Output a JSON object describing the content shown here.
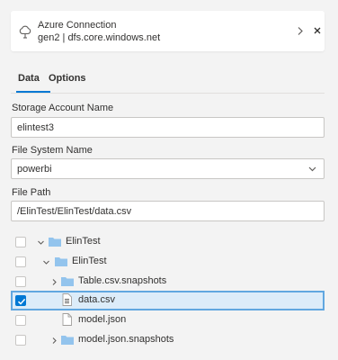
{
  "connection": {
    "title": "Azure Connection",
    "subtitle": "gen2 | dfs.core.windows.net",
    "icon": "cloud-icon"
  },
  "tabs": [
    {
      "label": "Data",
      "active": true
    },
    {
      "label": "Options",
      "active": false
    }
  ],
  "fields": {
    "storage_account": {
      "label": "Storage Account Name",
      "value": "elintest3"
    },
    "file_system": {
      "label": "File System Name",
      "value": "powerbi"
    },
    "file_path": {
      "label": "File Path",
      "value": "/ElinTest/ElinTest/data.csv"
    }
  },
  "tree": [
    {
      "label": "ElinTest",
      "type": "folder",
      "depth": 0,
      "expanded": true,
      "checked": false
    },
    {
      "label": "ElinTest",
      "type": "folder",
      "depth": 1,
      "expanded": true,
      "checked": false
    },
    {
      "label": "Table.csv.snapshots",
      "type": "folder",
      "depth": 2,
      "expanded": false,
      "checked": false
    },
    {
      "label": "data.csv",
      "type": "csv-file",
      "depth": 2,
      "checked": true,
      "selected": true
    },
    {
      "label": "model.json",
      "type": "file",
      "depth": 2,
      "checked": false
    },
    {
      "label": "model.json.snapshots",
      "type": "folder",
      "depth": 2,
      "expanded": false,
      "checked": false
    }
  ],
  "colors": {
    "accent": "#0078d4",
    "selected_row_bg": "#dcecf9",
    "selected_row_border": "#61a7e0",
    "folder": "#93c4ed"
  }
}
